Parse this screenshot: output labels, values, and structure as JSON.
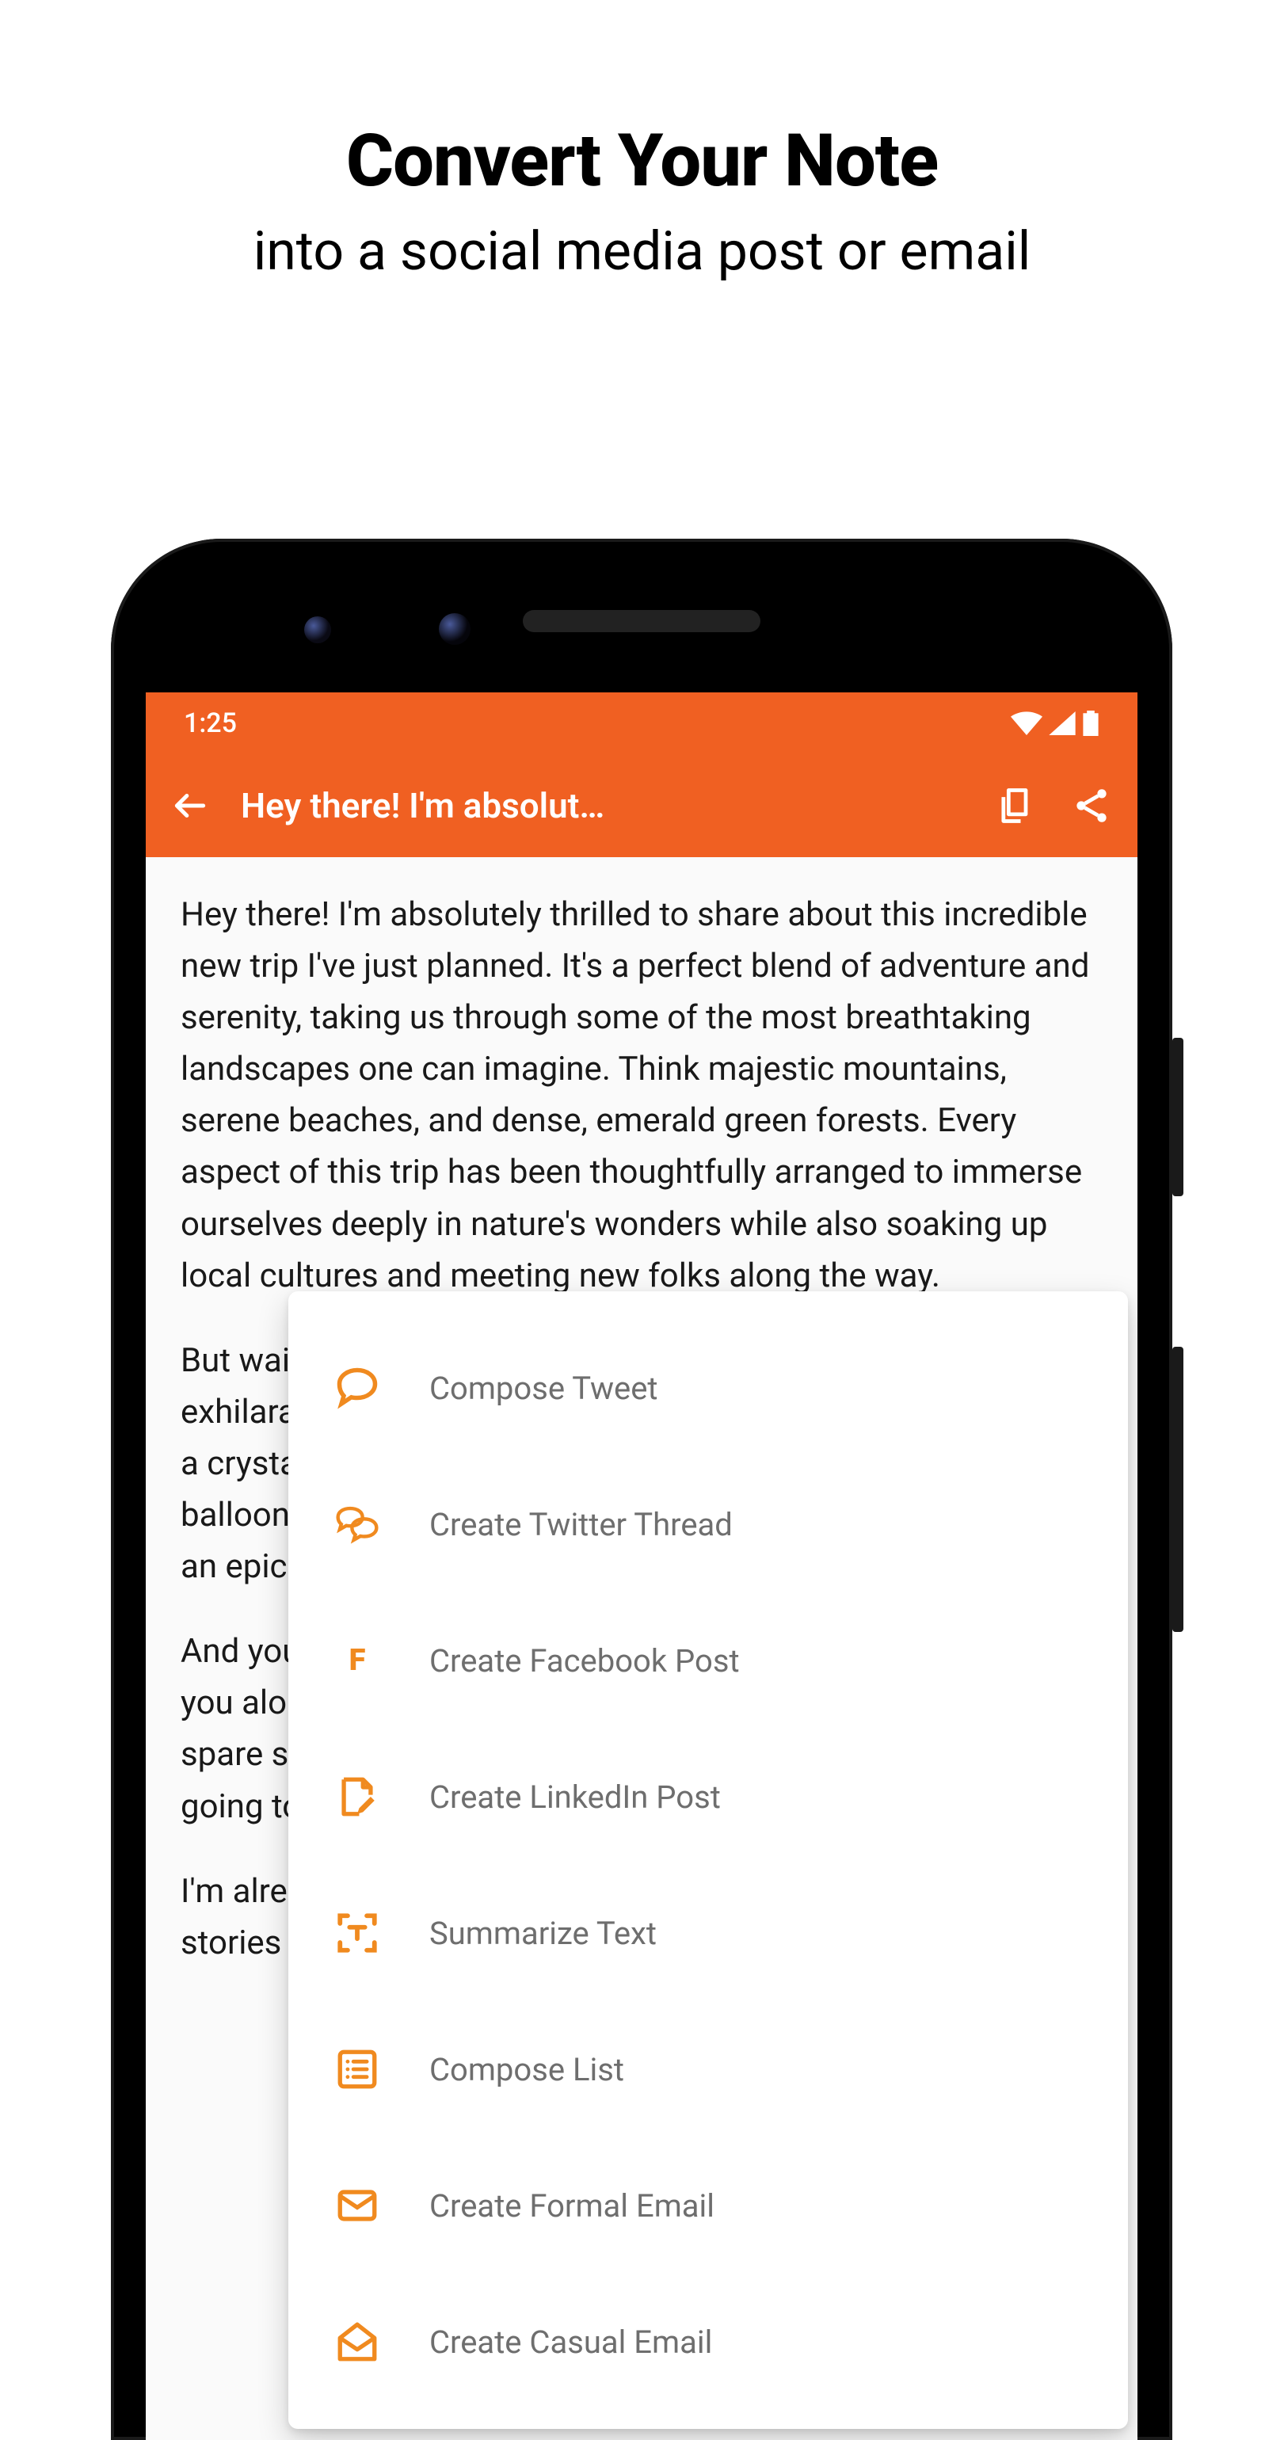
{
  "promo": {
    "title_bold": "Convert Your Note",
    "title_reg": "into a social media post or email"
  },
  "status": {
    "time": "1:25"
  },
  "appbar": {
    "title": "Hey there! I'm absolut…"
  },
  "note": {
    "paragraphs": [
      "Hey there! I'm absolutely thrilled to share about this incredible new trip I've just planned. It's a perfect blend of adventure and serenity, taking us through some of the most breathtaking landscapes one can imagine. Think majestic mountains, serene beaches, and dense, emerald green forests. Every aspect of this trip has been thoughtfully arranged to immerse ourselves deeply in nature's wonders while also soaking up local cultures and meeting new folks along the way.",
      "But wait, there's more! We're also lined up to tackle some exhilarating activities like a tough mountain hike, kayaking on a crystal-clear lake under a starlit sky, and a sunrise hot air balloon flight. It's all mapped out and I'm sure it's going to be an epic adventure.",
      "And you know what'd make this trip even more epic? Having you along! How about it, feeling a bit adventurous? We've got a spare spot and would be over the moon if you'd join us. It's going to be a journey packed with amazing memories.",
      "I'm already buzzing with excitement thinking about all the stories and photos I'll have to share."
    ]
  },
  "menu": {
    "items": [
      {
        "label": "Compose Tweet",
        "icon": "speech-bubble-icon"
      },
      {
        "label": "Create Twitter Thread",
        "icon": "speech-bubbles-icon"
      },
      {
        "label": "Create Facebook Post",
        "icon": "letter-f-icon"
      },
      {
        "label": "Create LinkedIn Post",
        "icon": "note-edit-icon"
      },
      {
        "label": "Summarize Text",
        "icon": "text-scan-icon"
      },
      {
        "label": "Compose List",
        "icon": "list-box-icon"
      },
      {
        "label": "Create Formal Email",
        "icon": "envelope-closed-icon"
      },
      {
        "label": "Create Casual Email",
        "icon": "envelope-open-icon"
      }
    ]
  },
  "colors": {
    "accent": "#f06022",
    "menu_icon": "#f08a1f"
  }
}
